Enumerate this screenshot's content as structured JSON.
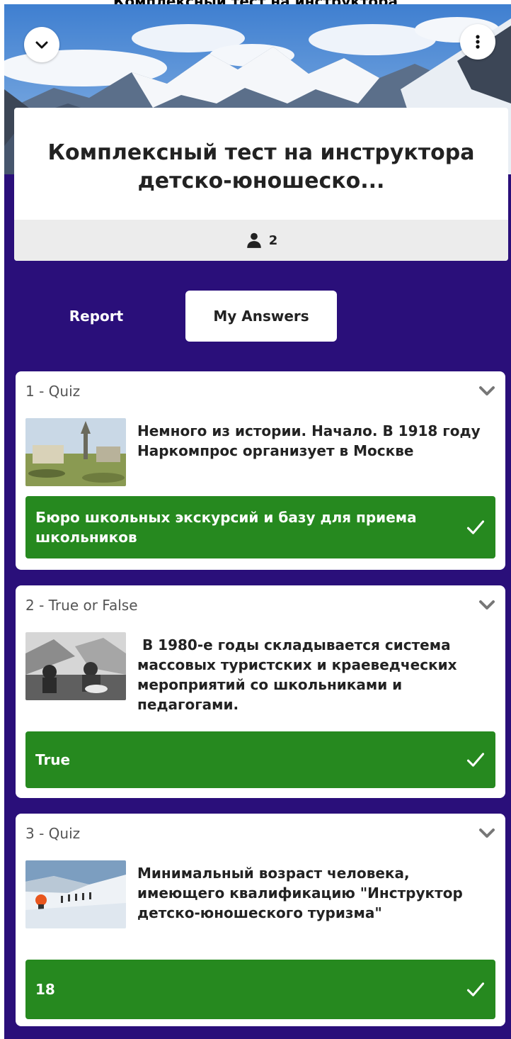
{
  "page_header_text": "Комплексный тест на инструктора",
  "header": {
    "title": "Комплексный тест на инструктора детско-юношеско...",
    "participants_count": "2",
    "icons": {
      "collapse": "chevron-down-icon",
      "menu": "more-vertical-icon",
      "participants": "person-icon"
    }
  },
  "tabs": [
    {
      "label": "Report",
      "selected": false
    },
    {
      "label": "My Answers",
      "selected": true
    }
  ],
  "questions": [
    {
      "header": "1 - Quiz",
      "text": "Немного из истории. Начало.  В 1918 году Наркомпрос организует в Москве",
      "answer": "Бюро школьных экскурсий и базу для приема школьников",
      "correct": true
    },
    {
      "header": "2 - True or False",
      "text": " В 1980-е годы складывается система массовых туристских и краеведческих мероприятий со школьниками и педагогами.",
      "answer": "True",
      "correct": true
    },
    {
      "header": "3 - Quiz",
      "text": "Минимальный возраст человека, имеющего квалификацию \"Инструктор детско-юношеского туризма\"",
      "answer": "18",
      "correct": true
    }
  ],
  "colors": {
    "background": "#2a0f7a",
    "correct": "#26891f",
    "card": "#ffffff"
  }
}
